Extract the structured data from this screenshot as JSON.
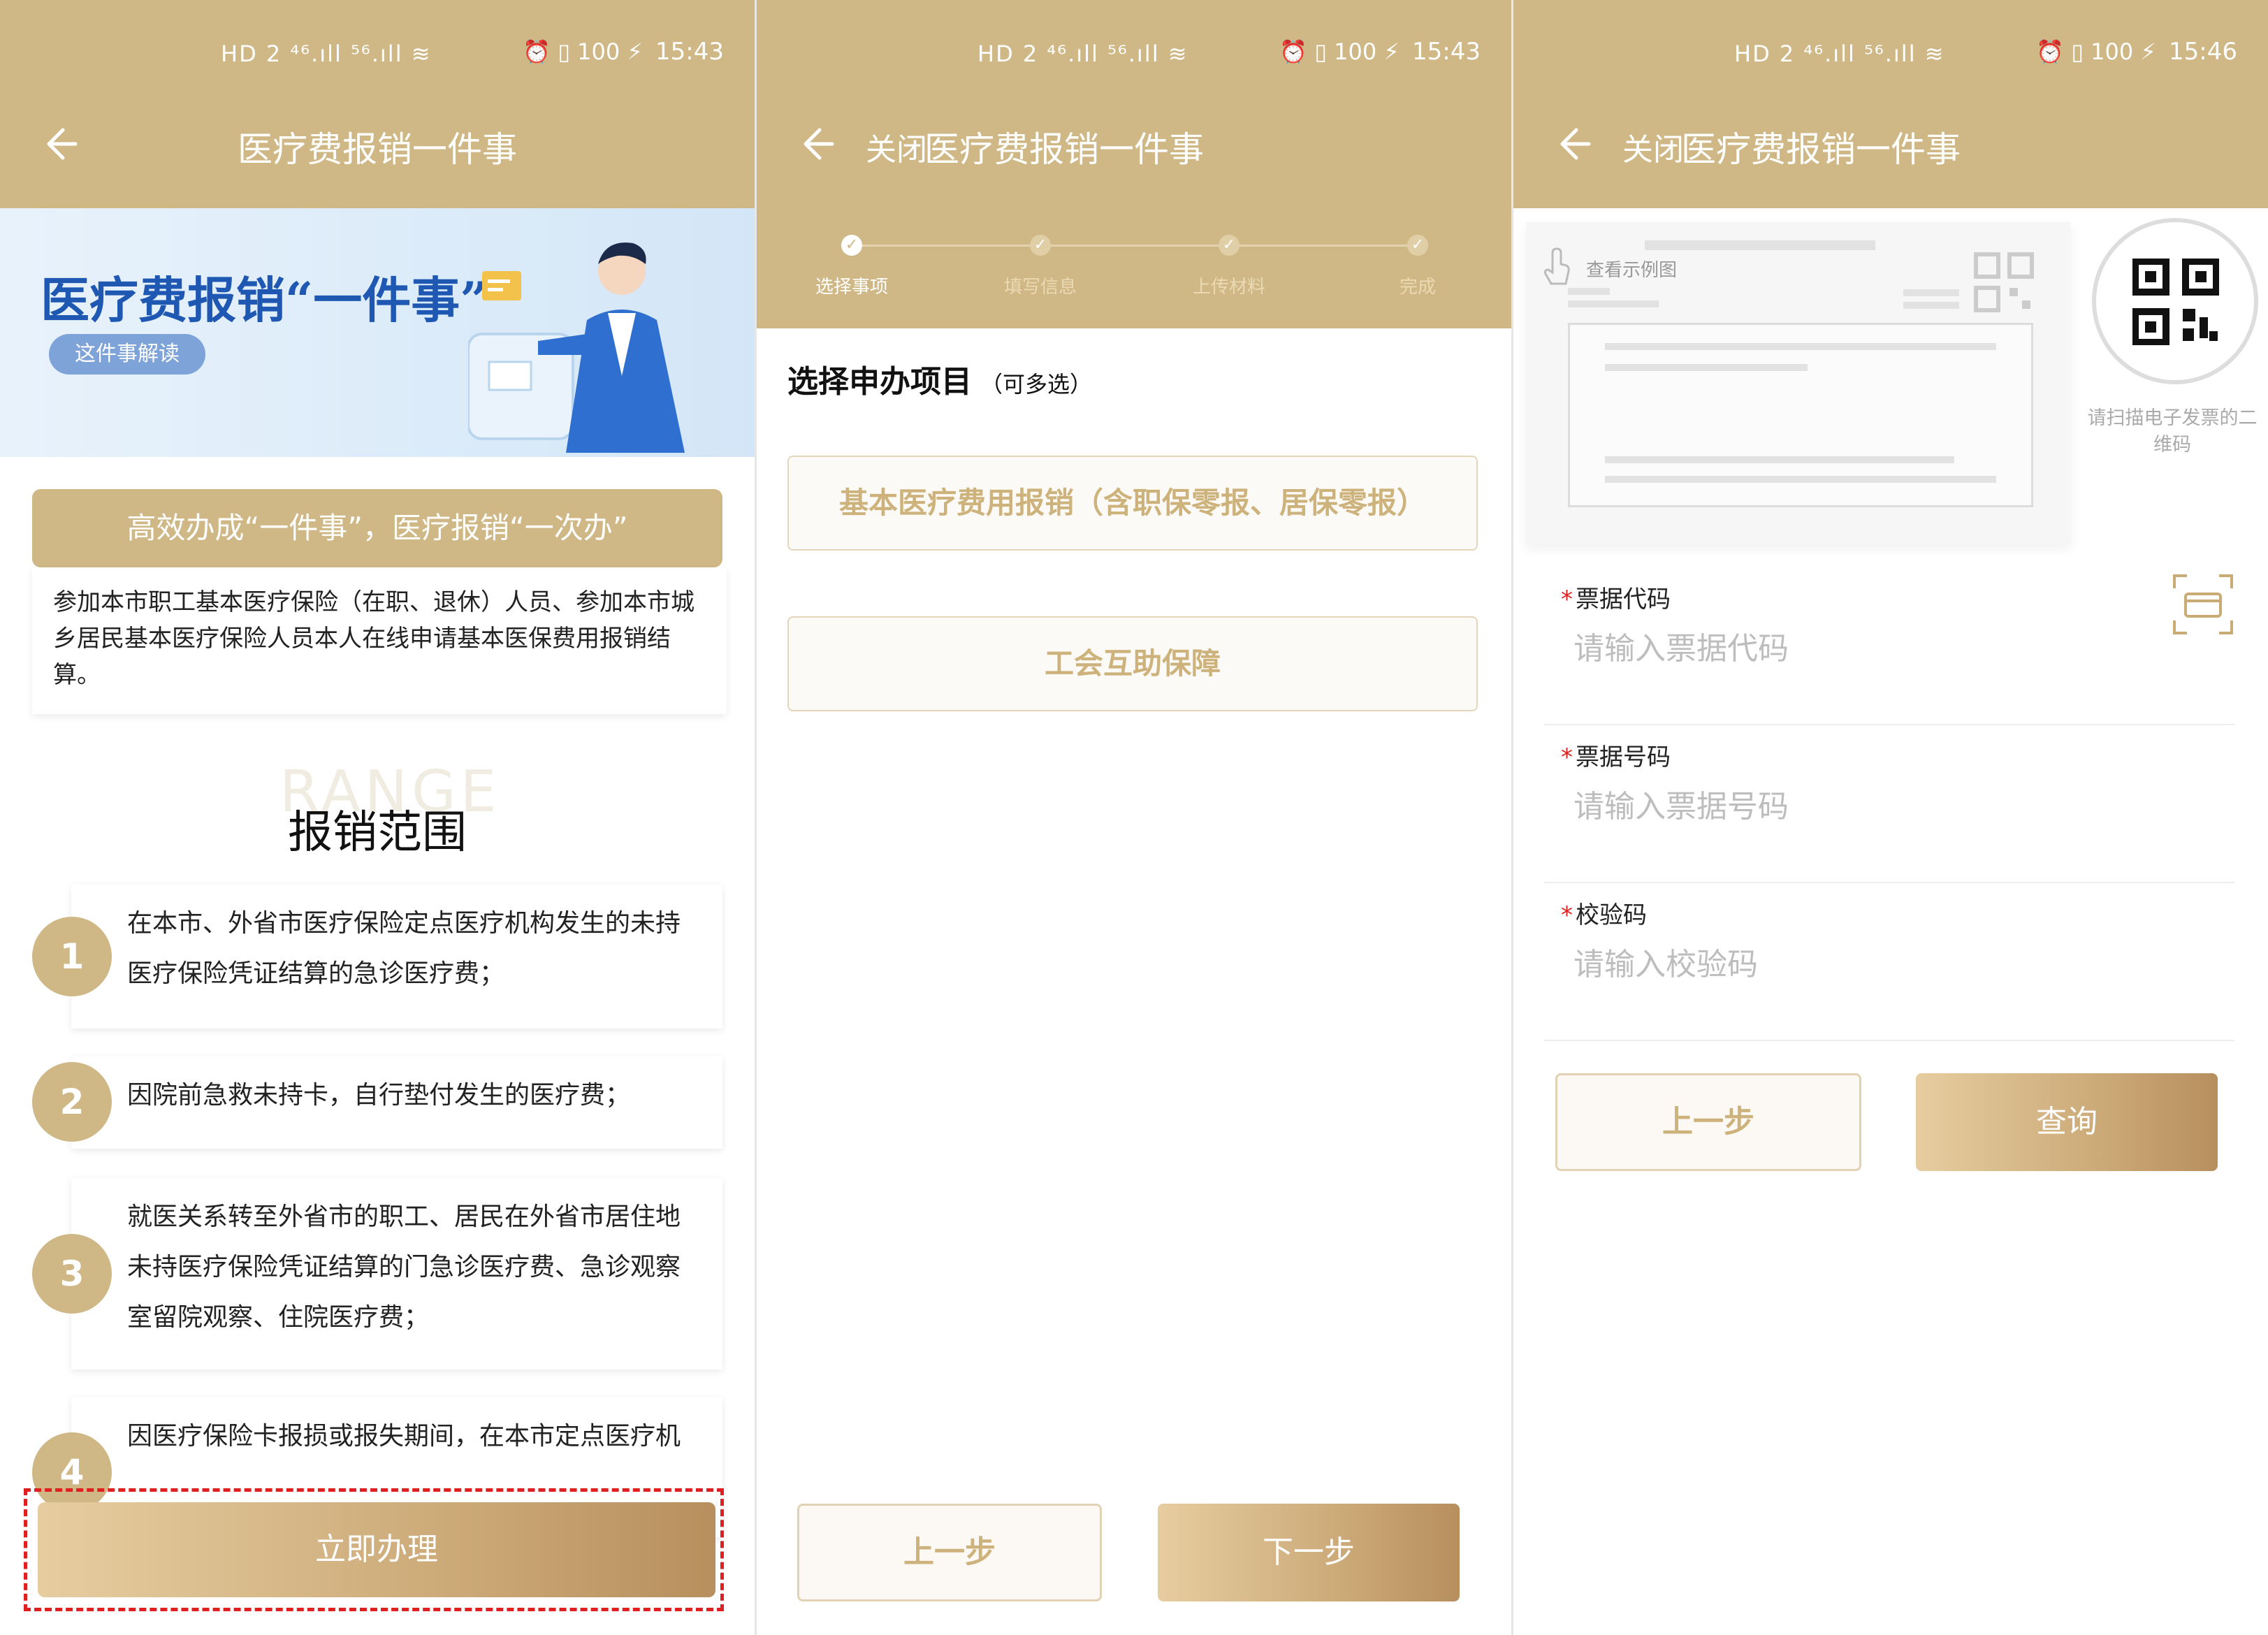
{
  "status": {
    "p1": {
      "left": "HD 2 ⁴⁶.ıll ⁵⁶.ıll ≋",
      "right": "⏰ ▯ 100 ⚡",
      "time": "15:43"
    },
    "p2": {
      "left": "HD 2 ⁴⁶.ıll ⁵⁶.ıll ≋",
      "right": "⏰ ▯ 100 ⚡",
      "time": "15:43"
    },
    "p3": {
      "left": "HD 2 ⁴⁶.ıll ⁵⁶.ıll ≋",
      "right": "⏰ ▯ 100 ⚡",
      "time": "15:46"
    }
  },
  "nav": {
    "title": "医疗费报销一件事",
    "close": "关闭"
  },
  "panel1": {
    "banner_title": "医疗费报销“一件事”",
    "banner_pill": "这件事解读",
    "headline": "高效办成“一件事”，医疗报销“一次办”",
    "intro": "参加本市职工基本医疗保险（在职、退休）人员、参加本市城乡居民基本医疗保险人员本人在线申请基本医保费用报销结算。",
    "watermark": "RANGE",
    "section_title": "报销范围",
    "items": [
      {
        "num": "1",
        "text": "在本市、外省市医疗保险定点医疗机构发生的未持医疗保险凭证结算的急诊医疗费；"
      },
      {
        "num": "2",
        "text": "因院前急救未持卡，自行垫付发生的医疗费；"
      },
      {
        "num": "3",
        "text": "就医关系转至外省市的职工、居民在外省市居住地未持医疗保险凭证结算的门急诊医疗费、急诊观察室留院观察、住院医疗费；"
      },
      {
        "num": "4",
        "text": "因医疗保险卡报损或报失期间，在本市定点医疗机"
      }
    ],
    "apply_button": "立即办理"
  },
  "panel2": {
    "steps": [
      {
        "label": "选择事项",
        "done": true
      },
      {
        "label": "填写信息",
        "done": false
      },
      {
        "label": "上传材料",
        "done": false
      },
      {
        "label": "完成",
        "done": false
      }
    ],
    "pick_title": "选择申办项目",
    "pick_note": "（可多选）",
    "options": [
      "基本医疗费用报销（含职保零报、居保零报）",
      "工会互助保障"
    ],
    "prev_button": "上一步",
    "next_button": "下一步"
  },
  "panel3": {
    "sample_hint": "查看示例图",
    "qr_caption": "请扫描电子发票的二维码",
    "fields": [
      {
        "label": "票据代码",
        "placeholder": "请输入票据代码",
        "value": ""
      },
      {
        "label": "票据号码",
        "placeholder": "请输入票据号码",
        "value": ""
      },
      {
        "label": "校验码",
        "placeholder": "请输入校验码",
        "value": ""
      }
    ],
    "prev_button": "上一步",
    "query_button": "查询"
  },
  "colors": {
    "brand_gold": "#cfb886",
    "highlight_red": "#e02020",
    "banner_blue": "#1f58b2"
  },
  "icons": [
    "back-arrow-icon",
    "check-icon",
    "hand-pointer-icon",
    "qr-code-icon",
    "scan-icon"
  ]
}
